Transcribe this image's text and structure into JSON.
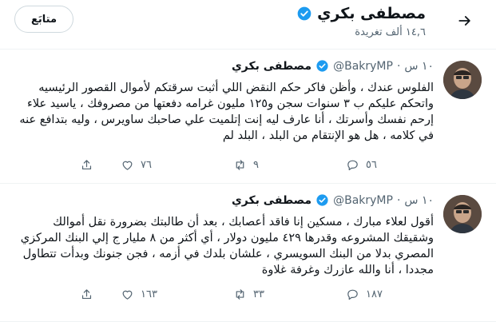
{
  "header": {
    "name": "مصطفى بكري",
    "tweet_count": "١٤,٦ ألف تغريدة",
    "follow_label": "متابَع"
  },
  "tweets": [
    {
      "name": "مصطفى بكري",
      "handle": "@BakryMP",
      "dot": "·",
      "time": "١٠ س",
      "text": "الفلوس عندك ، وأظن فاكر حكم النقض اللي أثبت سرقتكم لأموال القصور الرئيسيه واتحكم عليكم ب ٣ سنوات سجن و١٢٥ مليون غرامه دفعتها من مصروفك ، ياسيد علاء إرحم نفسك وأسرتك ، أنا عارف ليه إنت إتلميت علي صاحبك ساويرس ، وليه بتدافع عنه في كلامه ، هل هو الإنتقام من البلد ، البلد لم",
      "replies": "٥٦",
      "retweets": "٩",
      "likes": "٧٦"
    },
    {
      "name": "مصطفى بكري",
      "handle": "@BakryMP",
      "dot": "·",
      "time": "١٠ س",
      "text": "أقول لعلاء مبارك ، مسكين إنا فاقد أعصابك ، بعد أن طالبتك بضرورة نقل أموالك وشقيقك المشروعه وقدرها ٤٢٩ مليون دولار ، أي أكثر من ٨ مليار ج إلي البنك المركزي المصري بدلا من البنك السويسري ، علشان بلدك في أزمه ، فجن جنونك وبدأت تتطاول مجددا ، أنا والله عازرك وغرفة غلاوة",
      "replies": "١٨٧",
      "retweets": "٣٣",
      "likes": "١٦٣"
    }
  ],
  "icons": {
    "back": "arrow-right-icon",
    "verified": "verified-badge-icon",
    "reply": "reply-icon",
    "retweet": "retweet-icon",
    "like": "heart-icon",
    "share": "share-icon"
  },
  "colors": {
    "verified_blue": "#1d9bf0",
    "secondary_text": "#536471"
  }
}
